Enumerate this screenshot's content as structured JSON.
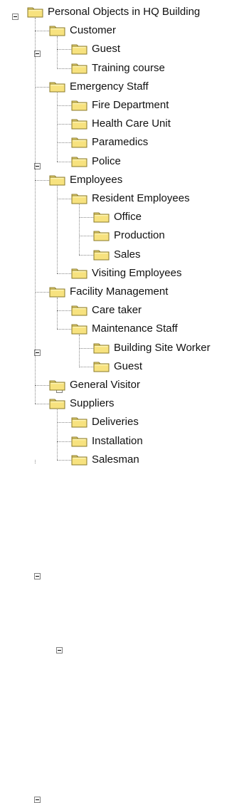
{
  "tree": {
    "root": {
      "label": "Personal Objects in HQ Building",
      "expanded": true,
      "children": [
        {
          "label": "Customer",
          "expanded": true,
          "children": [
            {
              "label": "Guest"
            },
            {
              "label": "Training course"
            }
          ]
        },
        {
          "label": "Emergency Staff",
          "expanded": true,
          "children": [
            {
              "label": "Fire Department"
            },
            {
              "label": "Health Care Unit"
            },
            {
              "label": "Paramedics"
            },
            {
              "label": "Police"
            }
          ]
        },
        {
          "label": "Employees",
          "expanded": true,
          "children": [
            {
              "label": "Resident Employees",
              "expanded": true,
              "children": [
                {
                  "label": "Office"
                },
                {
                  "label": "Production"
                },
                {
                  "label": "Sales"
                }
              ]
            },
            {
              "label": "Visiting Employees"
            }
          ]
        },
        {
          "label": "Facility Management",
          "expanded": true,
          "children": [
            {
              "label": "Care taker"
            },
            {
              "label": "Maintenance Staff",
              "expanded": true,
              "children": [
                {
                  "label": "Building Site Worker"
                },
                {
                  "label": "Guest"
                }
              ]
            }
          ]
        },
        {
          "label": "General Visitor"
        },
        {
          "label": "Suppliers",
          "expanded": true,
          "children": [
            {
              "label": "Deliveries"
            },
            {
              "label": "Installation"
            },
            {
              "label": "Salesman"
            }
          ]
        }
      ]
    }
  },
  "colors": {
    "folder_fill": "#f7e27f",
    "folder_light": "#fff6b8",
    "folder_edge": "#8a7a2a",
    "connector": "#888888",
    "text": "#111111"
  },
  "icons": {
    "folder": "folder-icon",
    "collapse": "collapse-toggle-icon"
  }
}
